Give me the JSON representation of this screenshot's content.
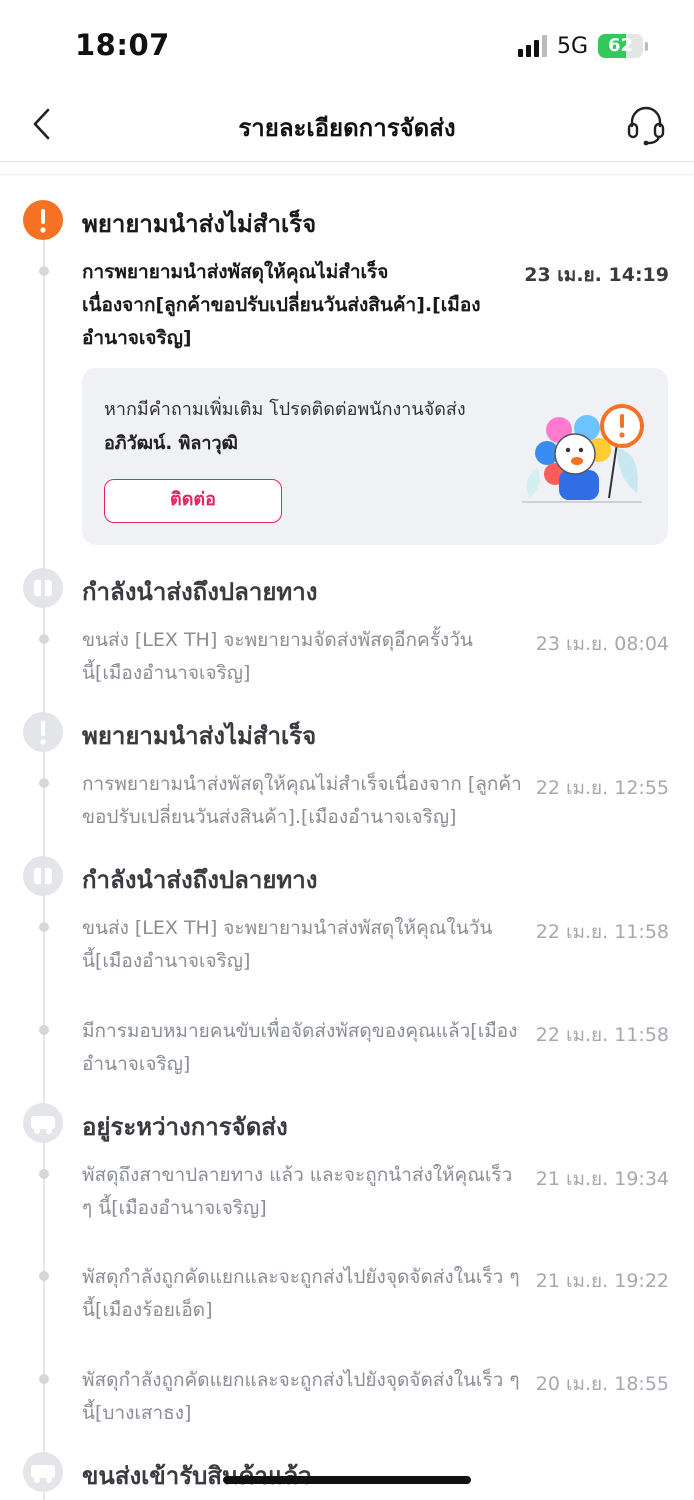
{
  "status_bar": {
    "time": "18:07",
    "network": "5G",
    "battery": "62",
    "battery_level": 0.62
  },
  "header": {
    "title": "รายละเอียดการจัดส่ง"
  },
  "card": {
    "message": "หากมีคำถามเพิ่มเติม โปรดติดต่อพนักงานจัดส่ง",
    "courier_name": "อภิวัฒน์.   พิลาวุฒิ",
    "contact_label": "ติดต่อ"
  },
  "timeline": [
    {
      "title": "พยายามนำส่งไม่สำเร็จ",
      "icon": "warning-icon",
      "events": [
        {
          "text": "การพยายามนำส่งพัสดุให้คุณไม่สำเร็จ เนื่องจาก[ลูกค้าขอปรับเปลี่ยนวันส่งสินค้า].[เมืองอำนาจเจริญ]",
          "time": "23 เม.ย. 14:19"
        }
      ]
    },
    {
      "title": "กำลังนำส่งถึงปลายทาง",
      "icon": "parcel-icon",
      "events": [
        {
          "text": "ขนส่ง [LEX TH] จะพยายามจัดส่งพัสดุอีกครั้งวันนี้[เมืองอำนาจเจริญ]",
          "time": "23 เม.ย. 08:04"
        }
      ]
    },
    {
      "title": "พยายามนำส่งไม่สำเร็จ",
      "icon": "warning-icon",
      "events": [
        {
          "text": "การพยายามนำส่งพัสดุให้คุณไม่สำเร็จเนื่องจาก [ลูกค้าขอปรับเปลี่ยนวันส่งสินค้า].[เมืองอำนาจเจริญ]",
          "time": "22 เม.ย. 12:55"
        }
      ]
    },
    {
      "title": "กำลังนำส่งถึงปลายทาง",
      "icon": "parcel-icon",
      "events": [
        {
          "text": "ขนส่ง [LEX TH] จะพยายามนำส่งพัสดุให้คุณในวันนี้[เมืองอำนาจเจริญ]",
          "time": "22 เม.ย. 11:58"
        },
        {
          "text": "มีการมอบหมายคนขับเพื่อจัดส่งพัสดุของคุณแล้ว[เมืองอำนาจเจริญ]",
          "time": "22 เม.ย. 11:58"
        }
      ]
    },
    {
      "title": "อยู่ระหว่างการจัดส่ง",
      "icon": "truck-icon",
      "events": [
        {
          "text": "พัสดุถึงสาขาปลายทาง แล้ว และจะถูกนำส่งให้คุณเร็ว ๆ นี้[เมืองอำนาจเจริญ]",
          "time": "21 เม.ย. 19:34"
        },
        {
          "text": "พัสดุกำลังถูกคัดแยกและจะถูกส่งไปยังจุดจัดส่งในเร็ว ๆ นี้[เมืองร้อยเอ็ด]",
          "time": "21 เม.ย. 19:22"
        },
        {
          "text": "พัสดุกำลังถูกคัดแยกและจะถูกส่งไปยังจุดจัดส่งในเร็ว ๆ นี้[บางเสาธง]",
          "time": "20 เม.ย. 18:55"
        }
      ]
    },
    {
      "title": "ขนส่งเข้ารับสินค้าแล้ว",
      "icon": "truck-icon",
      "events": []
    }
  ]
}
